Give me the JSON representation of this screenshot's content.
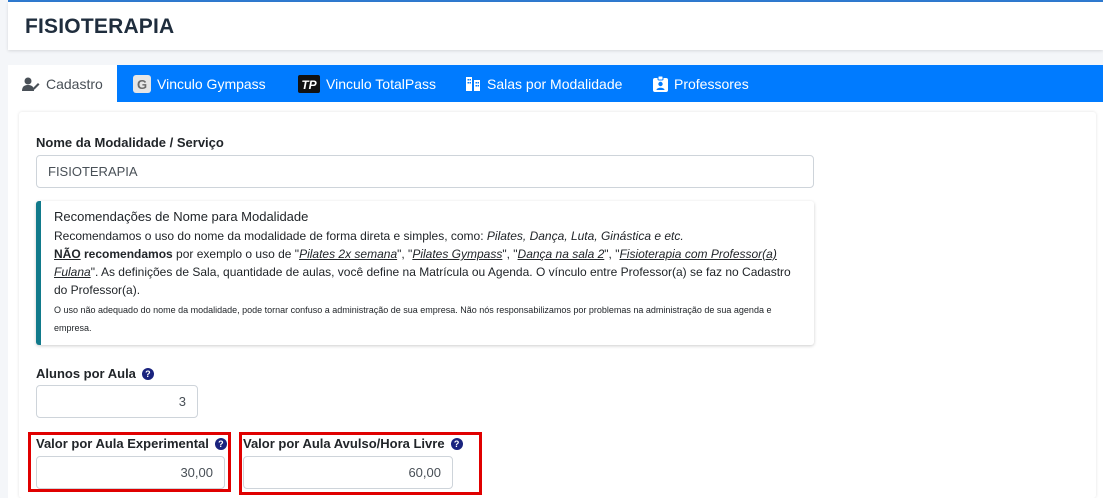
{
  "page_title": "FISIOTERAPIA",
  "tabs": [
    {
      "label": "Cadastro",
      "icon": "user-edit-icon",
      "active": true
    },
    {
      "label": "Vinculo Gympass",
      "icon": "gympass-logo-icon",
      "active": false
    },
    {
      "label": "Vinculo TotalPass",
      "icon": "totalpass-logo-icon",
      "active": false
    },
    {
      "label": "Salas por Modalidade",
      "icon": "building-icon",
      "active": false
    },
    {
      "label": "Professores",
      "icon": "id-badge-icon",
      "active": false
    }
  ],
  "form": {
    "name_label": "Nome da Modalidade / Serviço",
    "name_value": "FISIOTERAPIA",
    "students_label": "Alunos por Aula",
    "students_value": "3",
    "trial_label": "Valor por Aula Experimental",
    "trial_value": "30,00",
    "single_label": "Valor por Aula Avulso/Hora Livre",
    "single_value": "60,00"
  },
  "callout": {
    "title": "Recomendações de Nome para Modalidade",
    "line1_text": "Recomendamos o uso do nome da modalidade de forma direta e simples, como: ",
    "line1_examples": "Pilates, Dança, Luta, Ginástica e etc.",
    "not_word": "NÃO",
    "recommend_word": " recomendamos",
    "line2_text": " por exemplo o uso de \"",
    "ex1": "Pilates 2x semana",
    "sep1": "\", \"",
    "ex2": "Pilates Gympass",
    "sep2": "\", \"",
    "ex3": "Dança na sala 2",
    "sep3": "\", \"",
    "ex4": "Fisioterapia com Professor(a) Fulana",
    "line3_text": "\". As definições de Sala, quantidade de aulas, você define na Matrícula ou Agenda. O vínculo entre Professor(a) se faz no Cadastro do Professor(a).",
    "small_note": "O uso não adequado do nome da modalidade, pode tornar confuso a administração de sua empresa. Não nós responsabilizamos por problemas na administração de sua agenda e empresa."
  },
  "colors": {
    "tab_bar": "#007bff",
    "callout_border": "#117a8b",
    "highlight_box": "#e00000"
  }
}
